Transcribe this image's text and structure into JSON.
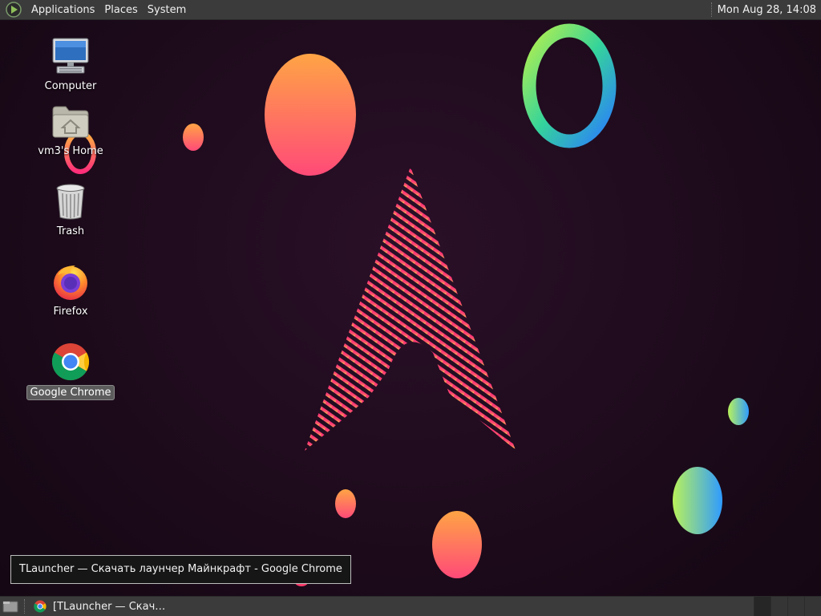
{
  "top_panel": {
    "menus": [
      "Applications",
      "Places",
      "System"
    ],
    "clock": "Mon Aug 28, 14:08"
  },
  "desktop_icons": [
    {
      "label": "Computer",
      "icon": "computer-icon"
    },
    {
      "label": "vm3's Home",
      "icon": "home-folder-icon"
    },
    {
      "label": "Trash",
      "icon": "trash-icon"
    },
    {
      "label": "Firefox",
      "icon": "firefox-icon"
    },
    {
      "label": "Google Chrome",
      "icon": "chrome-icon",
      "selected": true
    }
  ],
  "tooltip": {
    "text": "TLauncher — Скачать лаунчер Майнкрафт - Google Chrome"
  },
  "taskbar": {
    "tasks": [
      {
        "label": "[TLauncher — Скач…",
        "icon": "chrome-icon"
      }
    ],
    "workspaces": 4
  },
  "colors": {
    "panel": "#3b3b3b",
    "wallpaper": "#1e0c1c",
    "accent_pink": "#ff2e8a",
    "accent_orange": "#ff9a3c"
  }
}
